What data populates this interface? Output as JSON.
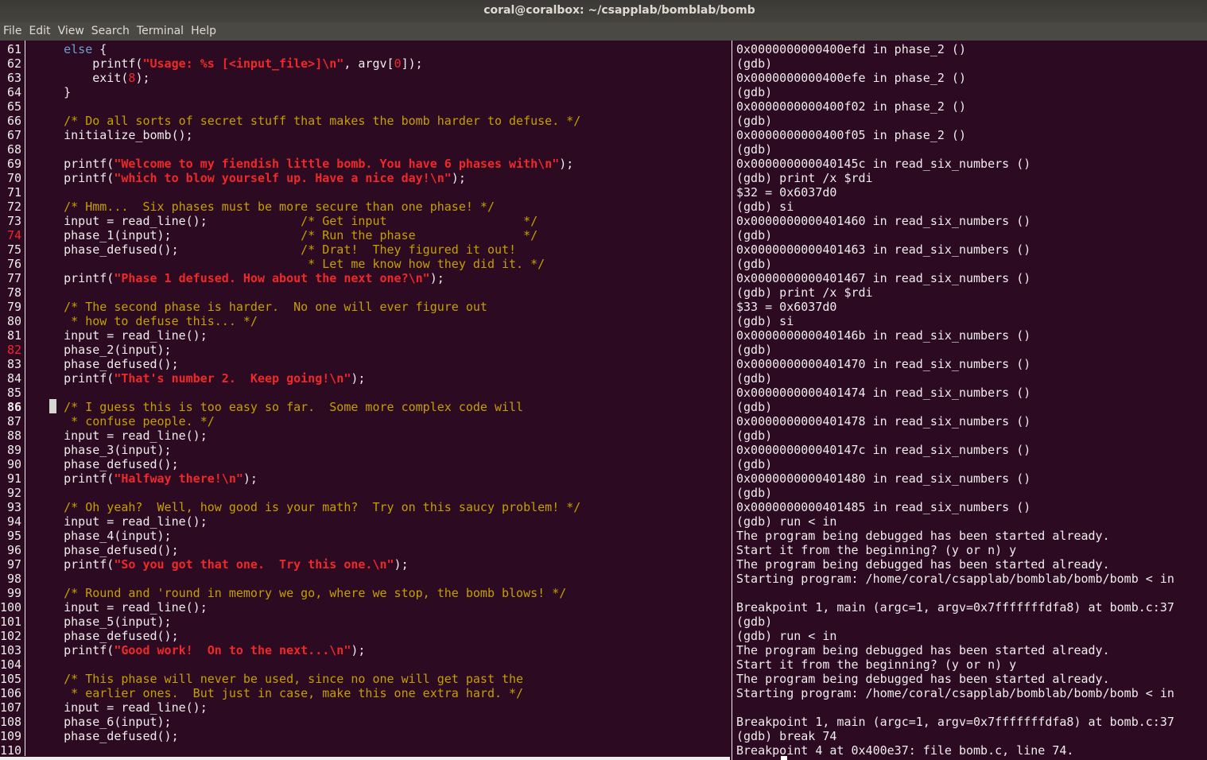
{
  "window": {
    "title": "coral@coralbox: ~/csapplab/bomblab/bomb"
  },
  "menu": [
    "File",
    "Edit",
    "View",
    "Search",
    "Terminal",
    "Help"
  ],
  "colors": {
    "background": "#2c0a22",
    "string": "#ef2929",
    "comment": "#c4a000",
    "keyword": "#729fcf"
  },
  "source": {
    "breakpoints": [
      74,
      82
    ],
    "current_line": 86,
    "lines": [
      {
        "n": 61,
        "s": [
          [
            "",
            "    "
          ],
          [
            "kw",
            "else"
          ],
          [
            "",
            " {"
          ]
        ]
      },
      {
        "n": 62,
        "s": [
          [
            "",
            "        printf("
          ],
          [
            "str",
            "\"Usage: %s [<input_file>]\\n\""
          ],
          [
            "",
            ", argv["
          ],
          [
            "num",
            "0"
          ],
          [
            "",
            "]);"
          ]
        ]
      },
      {
        "n": 63,
        "s": [
          [
            "",
            "        exit("
          ],
          [
            "num",
            "8"
          ],
          [
            "",
            ");"
          ]
        ]
      },
      {
        "n": 64,
        "s": [
          [
            "",
            "    }"
          ]
        ]
      },
      {
        "n": 65,
        "s": []
      },
      {
        "n": 66,
        "s": [
          [
            "cm",
            "    /* Do all sorts of secret stuff that makes the bomb harder to defuse. */"
          ]
        ]
      },
      {
        "n": 67,
        "s": [
          [
            "",
            "    initialize_bomb();"
          ]
        ]
      },
      {
        "n": 68,
        "s": []
      },
      {
        "n": 69,
        "s": [
          [
            "",
            "    printf("
          ],
          [
            "str",
            "\"Welcome to my fiendish little bomb. You have 6 phases with\\n\""
          ],
          [
            "",
            ");"
          ]
        ]
      },
      {
        "n": 70,
        "s": [
          [
            "",
            "    printf("
          ],
          [
            "str",
            "\"which to blow yourself up. Have a nice day!\\n\""
          ],
          [
            "",
            ");"
          ]
        ]
      },
      {
        "n": 71,
        "s": []
      },
      {
        "n": 72,
        "s": [
          [
            "cm",
            "    /* Hmm...  Six phases must be more secure than one phase! */"
          ]
        ]
      },
      {
        "n": 73,
        "s": [
          [
            "",
            "    input = read_line();             "
          ],
          [
            "cm",
            "/* Get input                   */"
          ]
        ]
      },
      {
        "n": 74,
        "s": [
          [
            "",
            "    phase_1(input);                  "
          ],
          [
            "cm",
            "/* Run the phase               */"
          ]
        ]
      },
      {
        "n": 75,
        "s": [
          [
            "",
            "    phase_defused();                 "
          ],
          [
            "cm",
            "/* Drat!  They figured it out!"
          ]
        ]
      },
      {
        "n": 76,
        "s": [
          [
            "cm",
            "                                      * Let me know how they did it. */"
          ]
        ]
      },
      {
        "n": 77,
        "s": [
          [
            "",
            "    printf("
          ],
          [
            "str",
            "\"Phase 1 defused. How about the next one?\\n\""
          ],
          [
            "",
            ");"
          ]
        ]
      },
      {
        "n": 78,
        "s": []
      },
      {
        "n": 79,
        "s": [
          [
            "cm",
            "    /* The second phase is harder.  No one will ever figure out"
          ]
        ]
      },
      {
        "n": 80,
        "s": [
          [
            "cm",
            "     * how to defuse this... */"
          ]
        ]
      },
      {
        "n": 81,
        "s": [
          [
            "",
            "    input = read_line();"
          ]
        ]
      },
      {
        "n": 82,
        "s": [
          [
            "",
            "    phase_2(input);"
          ]
        ]
      },
      {
        "n": 83,
        "s": [
          [
            "",
            "    phase_defused();"
          ]
        ]
      },
      {
        "n": 84,
        "s": [
          [
            "",
            "    printf("
          ],
          [
            "str",
            "\"That's number 2.  Keep going!\\n\""
          ],
          [
            "",
            ");"
          ]
        ]
      },
      {
        "n": 85,
        "s": []
      },
      {
        "n": 86,
        "s": [
          [
            "cm",
            "    /* I guess this is too easy so far.  Some more complex code will"
          ]
        ]
      },
      {
        "n": 87,
        "s": [
          [
            "cm",
            "     * confuse people. */"
          ]
        ]
      },
      {
        "n": 88,
        "s": [
          [
            "",
            "    input = read_line();"
          ]
        ]
      },
      {
        "n": 89,
        "s": [
          [
            "",
            "    phase_3(input);"
          ]
        ]
      },
      {
        "n": 90,
        "s": [
          [
            "",
            "    phase_defused();"
          ]
        ]
      },
      {
        "n": 91,
        "s": [
          [
            "",
            "    printf("
          ],
          [
            "str",
            "\"Halfway there!\\n\""
          ],
          [
            "",
            ");"
          ]
        ]
      },
      {
        "n": 92,
        "s": []
      },
      {
        "n": 93,
        "s": [
          [
            "cm",
            "    /* Oh yeah?  Well, how good is your math?  Try on this saucy problem! */"
          ]
        ]
      },
      {
        "n": 94,
        "s": [
          [
            "",
            "    input = read_line();"
          ]
        ]
      },
      {
        "n": 95,
        "s": [
          [
            "",
            "    phase_4(input);"
          ]
        ]
      },
      {
        "n": 96,
        "s": [
          [
            "",
            "    phase_defused();"
          ]
        ]
      },
      {
        "n": 97,
        "s": [
          [
            "",
            "    printf("
          ],
          [
            "str",
            "\"So you got that one.  Try this one.\\n\""
          ],
          [
            "",
            ");"
          ]
        ]
      },
      {
        "n": 98,
        "s": []
      },
      {
        "n": 99,
        "s": [
          [
            "cm",
            "    /* Round and 'round in memory we go, where we stop, the bomb blows! */"
          ]
        ]
      },
      {
        "n": 100,
        "s": [
          [
            "",
            "    input = read_line();"
          ]
        ]
      },
      {
        "n": 101,
        "s": [
          [
            "",
            "    phase_5(input);"
          ]
        ]
      },
      {
        "n": 102,
        "s": [
          [
            "",
            "    phase_defused();"
          ]
        ]
      },
      {
        "n": 103,
        "s": [
          [
            "",
            "    printf("
          ],
          [
            "str",
            "\"Good work!  On to the next...\\n\""
          ],
          [
            "",
            ");"
          ]
        ]
      },
      {
        "n": 104,
        "s": []
      },
      {
        "n": 105,
        "s": [
          [
            "cm",
            "    /* This phase will never be used, since no one will get past the"
          ]
        ]
      },
      {
        "n": 106,
        "s": [
          [
            "cm",
            "     * earlier ones.  But just in case, make this one extra hard. */"
          ]
        ]
      },
      {
        "n": 107,
        "s": [
          [
            "",
            "    input = read_line();"
          ]
        ]
      },
      {
        "n": 108,
        "s": [
          [
            "",
            "    phase_6(input);"
          ]
        ]
      },
      {
        "n": 109,
        "s": [
          [
            "",
            "    phase_defused();"
          ]
        ]
      },
      {
        "n": 110,
        "s": []
      }
    ]
  },
  "gdb": [
    "0x0000000000400efd in phase_2 ()",
    "(gdb)",
    "0x0000000000400efe in phase_2 ()",
    "(gdb)",
    "0x0000000000400f02 in phase_2 ()",
    "(gdb)",
    "0x0000000000400f05 in phase_2 ()",
    "(gdb)",
    "0x000000000040145c in read_six_numbers ()",
    "(gdb) print /x $rdi",
    "$32 = 0x6037d0",
    "(gdb) si",
    "0x0000000000401460 in read_six_numbers ()",
    "(gdb)",
    "0x0000000000401463 in read_six_numbers ()",
    "(gdb)",
    "0x0000000000401467 in read_six_numbers ()",
    "(gdb) print /x $rdi",
    "$33 = 0x6037d0",
    "(gdb) si",
    "0x000000000040146b in read_six_numbers ()",
    "(gdb)",
    "0x0000000000401470 in read_six_numbers ()",
    "(gdb)",
    "0x0000000000401474 in read_six_numbers ()",
    "(gdb)",
    "0x0000000000401478 in read_six_numbers ()",
    "(gdb)",
    "0x000000000040147c in read_six_numbers ()",
    "(gdb)",
    "0x0000000000401480 in read_six_numbers ()",
    "(gdb)",
    "0x0000000000401485 in read_six_numbers ()",
    "(gdb) run < in",
    "The program being debugged has been started already.",
    "Start it from the beginning? (y or n) y",
    "The program being debugged has been started already.",
    "Starting program: /home/coral/csapplab/bomblab/bomb/bomb < in",
    "",
    "Breakpoint 1, main (argc=1, argv=0x7fffffffdfa8) at bomb.c:37",
    "(gdb)",
    "(gdb) run < in",
    "The program being debugged has been started already.",
    "Start it from the beginning? (y or n) y",
    "The program being debugged has been started already.",
    "Starting program: /home/coral/csapplab/bomblab/bomb/bomb < in",
    "",
    "Breakpoint 1, main (argc=1, argv=0x7fffffffdfa8) at bomb.c:37",
    "(gdb) break 74",
    "Breakpoint 4 at 0x400e37: file bomb.c, line 74."
  ]
}
